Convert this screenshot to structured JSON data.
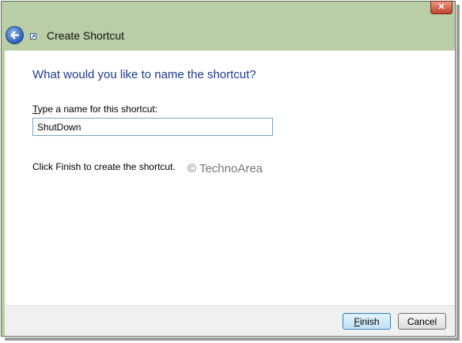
{
  "window": {
    "title": "Create Shortcut",
    "close_symbol": "✕",
    "back_icon": "back-arrow-icon",
    "app_icon": "shortcut-icon"
  },
  "main": {
    "heading": "What would you like to name the shortcut?",
    "field_label_access_key": "T",
    "field_label_rest": "ype a name for this shortcut:",
    "shortcut_name": "ShutDown",
    "instruction": "Click Finish to create the shortcut.",
    "watermark": "© TechnoArea"
  },
  "footer": {
    "finish_access_key": "F",
    "finish_rest": "inish",
    "cancel_label": "Cancel"
  },
  "colors": {
    "titlebar": "#b9cda6",
    "heading": "#1e3c8c",
    "close": "#c0422a",
    "accent": "#2b5fb4"
  }
}
